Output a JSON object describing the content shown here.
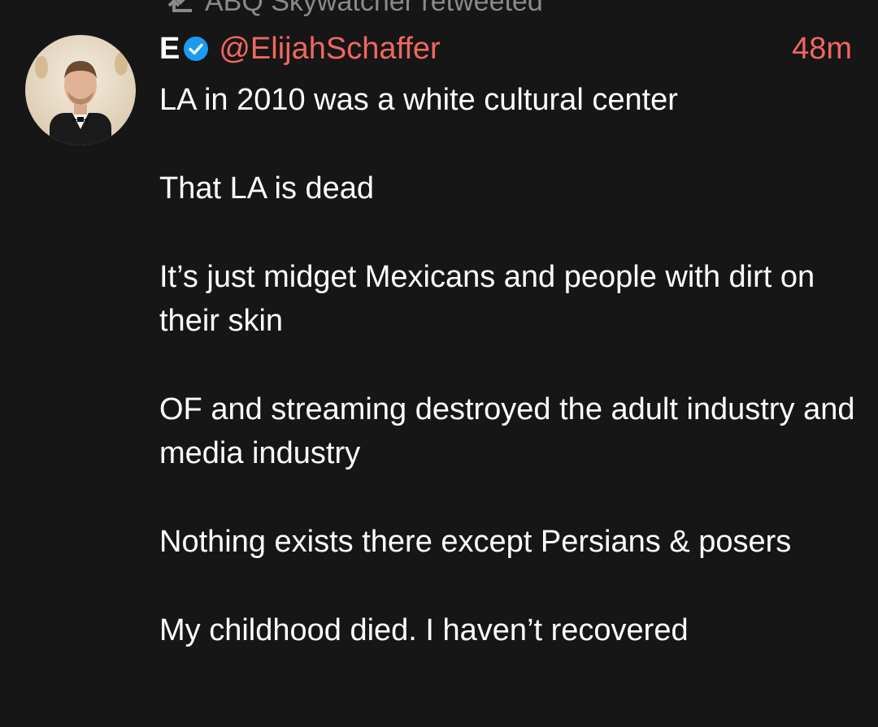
{
  "retweet": {
    "icon": "retweet-icon",
    "text": "ABQ Skywatcher retweeted"
  },
  "tweet": {
    "avatar_icon": "avatar",
    "display_name": "E",
    "verified_icon": "verified-badge-icon",
    "handle": "@ElijahSchaffer",
    "time": "48m",
    "paragraphs": [
      "LA in 2010 was a white cultural center",
      "That LA is dead",
      "It’s just midget Mexicans and people with dirt on their skin",
      "OF and streaming destroyed the adult industry and media industry",
      "Nothing exists there except Persians & posers",
      "My childhood died. I haven’t recovered"
    ]
  },
  "colors": {
    "background": "#161616",
    "text": "#ffffff",
    "handle": "#f0675f",
    "retweet_banner": "#8a8a8a",
    "verified": "#1d9bf0"
  }
}
